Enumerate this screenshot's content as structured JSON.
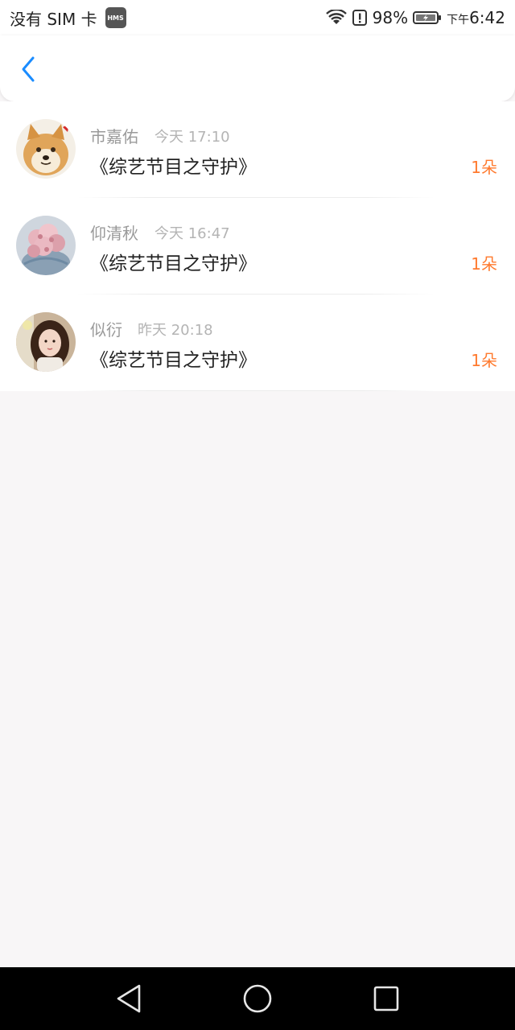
{
  "status_bar": {
    "carrier": "没有 SIM 卡",
    "hms_badge": "HMS",
    "battery_percent": "98%",
    "time_prefix": "下午",
    "time": "6:42",
    "icons": [
      "wifi-icon",
      "alert-icon",
      "battery-icon"
    ]
  },
  "app_bar": {
    "back_icon": "chevron-left-icon",
    "accent_color": "#1a8cff"
  },
  "list": {
    "items": [
      {
        "name": "市嘉佑",
        "time": "今天 17:10",
        "title": "《综艺节目之守护》",
        "count": "1朵",
        "avatar": "shiba-dog-avatar"
      },
      {
        "name": "仰清秋",
        "time": "今天 16:47",
        "title": "《综艺节目之守护》",
        "count": "1朵",
        "avatar": "flower-bouquet-avatar"
      },
      {
        "name": "似衍",
        "time": "昨天 20:18",
        "title": "《综艺节目之守护》",
        "count": "1朵",
        "avatar": "girl-portrait-avatar"
      }
    ],
    "count_color": "#ff7a2e"
  },
  "nav_bar": {
    "buttons": [
      "back-triangle-icon",
      "home-circle-icon",
      "recents-square-icon"
    ]
  }
}
